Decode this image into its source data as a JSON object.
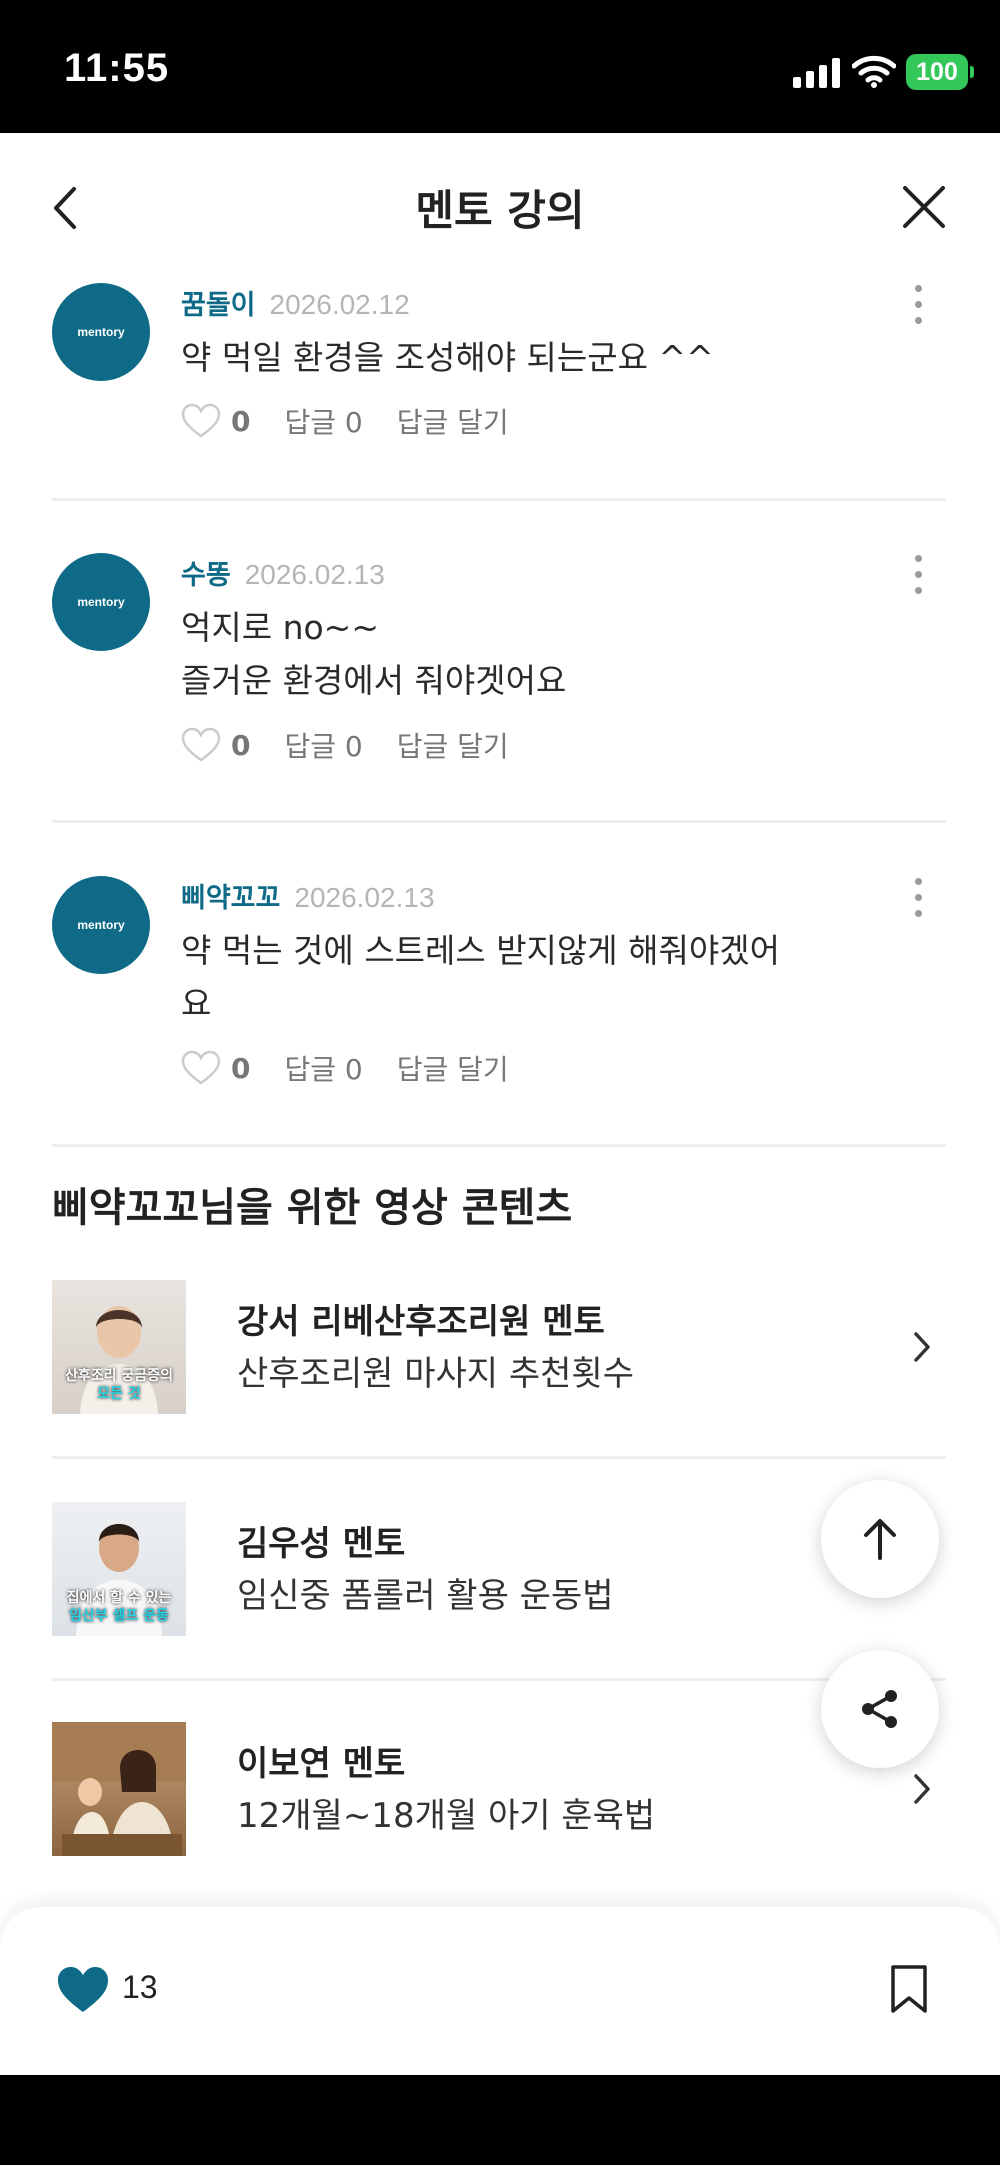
{
  "status_bar": {
    "time": "11:55",
    "battery": "100"
  },
  "header": {
    "title": "멘토 강의",
    "back_icon": "chevron-left-icon",
    "close_icon": "close-icon"
  },
  "comments": [
    {
      "author": "꿈돌이",
      "date": "2026.02.12",
      "lines": [
        "약 먹일 환경을 조성해야 되는군요 ^^"
      ],
      "likes": "0",
      "replies": "답글 0",
      "reply_action": "답글 달기",
      "avatar_text": "mentory"
    },
    {
      "author": "수똥",
      "date": "2026.02.13",
      "lines": [
        "억지로 no~~",
        "즐거운 환경에서 줘야겟어요"
      ],
      "likes": "0",
      "replies": "답글 0",
      "reply_action": "답글 달기",
      "avatar_text": "mentory"
    },
    {
      "author": "삐약꼬꼬",
      "date": "2026.02.13",
      "lines": [
        "약 먹는 것에 스트레스 받지않게 해줘야겠어",
        "요"
      ],
      "likes": "0",
      "replies": "답글 0",
      "reply_action": "답글 달기",
      "avatar_text": "mentory"
    }
  ],
  "videos_section": {
    "title": "삐약꼬꼬님을 위한 영상 콘텐츠",
    "items": [
      {
        "mentor": "강서 리베산후조리원 멘토",
        "topic": "산후조리원 마사지 추천횟수",
        "thumb_caption_1": "산후조리 궁금증의",
        "thumb_caption_2": "모든 것"
      },
      {
        "mentor": "김우성 멘토",
        "topic": "임신중 폼롤러 활용 운동법",
        "thumb_caption_1": "집에서 할 수 있는",
        "thumb_caption_2": "임산부 셀프 운동"
      },
      {
        "mentor": "이보연 멘토",
        "topic": "12개월~18개월 아기 훈육법"
      }
    ]
  },
  "floating": {
    "scroll_top_icon": "arrow-up-icon",
    "share_icon": "share-icon"
  },
  "bottom_bar": {
    "like_count": "13",
    "accent": "#0e6a86"
  }
}
